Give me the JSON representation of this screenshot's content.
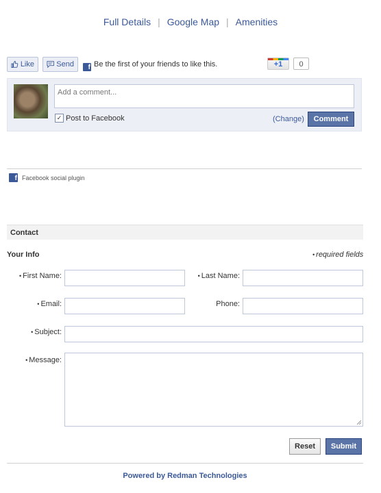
{
  "nav": {
    "links": [
      "Full Details",
      "Google Map",
      "Amenities"
    ],
    "separator": "|"
  },
  "facebook": {
    "like_label": "Like",
    "send_label": "Send",
    "like_text": "Be the first of your friends to like this.",
    "comment_placeholder": "Add a comment...",
    "post_to_facebook_label": "Post to Facebook",
    "post_to_facebook_checked": true,
    "change_link": "(Change)",
    "comment_button": "Comment",
    "plugin_label": "Facebook social plugin"
  },
  "google": {
    "plusone_label": "+1",
    "plusone_count": "0"
  },
  "contact": {
    "section_title": "Contact",
    "subtitle": "Your Info",
    "required_note": "required fields",
    "bullet": "•",
    "labels": {
      "first_name": "First Name:",
      "last_name": "Last Name:",
      "email": "Email:",
      "phone": "Phone:",
      "subject": "Subject:",
      "message": "Message:"
    },
    "reset_button": "Reset",
    "submit_button": "Submit"
  },
  "footer": {
    "powered_by": "Powered by Redman Technologies"
  },
  "colors": {
    "facebook_blue": "#3b5998",
    "button_blue": "#5b74a8"
  }
}
